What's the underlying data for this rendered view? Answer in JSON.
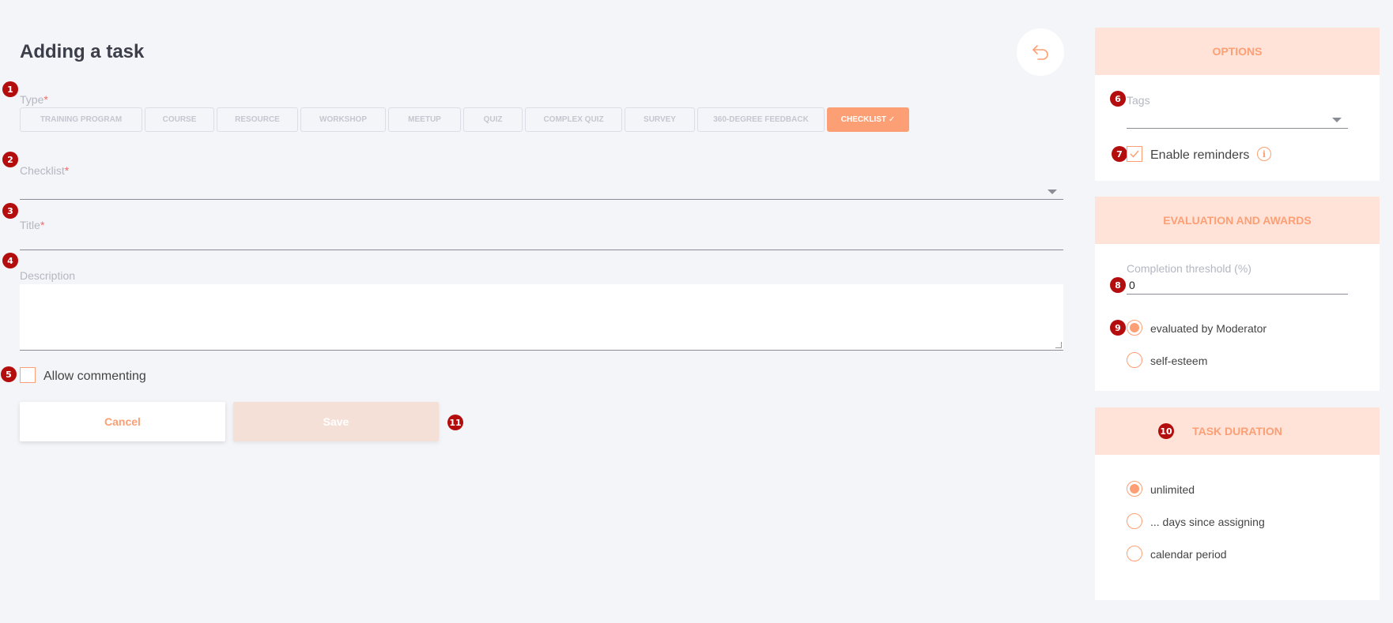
{
  "page": {
    "title": "Adding a task"
  },
  "form": {
    "type_label": "Type",
    "type_required": "*",
    "type_options": [
      "TRAINING PROGRAM",
      "COURSE",
      "RESOURCE",
      "WORKSHOP",
      "MEETUP",
      "QUIZ",
      "COMPLEX QUIZ",
      "SURVEY",
      "360-DEGREE FEEDBACK",
      "CHECKLIST"
    ],
    "type_selected": "CHECKLIST",
    "type_selected_mark": "✓",
    "checklist_label": "Checklist",
    "checklist_required": "*",
    "checklist_value": "",
    "title_label": "Title",
    "title_required": "*",
    "title_value": "",
    "description_label": "Description",
    "description_value": "",
    "allow_commenting_label": "Allow commenting",
    "allow_commenting_checked": false,
    "cancel_label": "Cancel",
    "save_label": "Save"
  },
  "options": {
    "header": "OPTIONS",
    "tags_label": "Tags",
    "tags_value": "",
    "reminders_label": "Enable reminders",
    "reminders_checked": true,
    "info_icon": "i"
  },
  "evaluation": {
    "header": "EVALUATION AND AWARDS",
    "threshold_label": "Completion threshold (%)",
    "threshold_value": "0",
    "options": [
      "evaluated by Moderator",
      "self-esteem"
    ],
    "selected": "evaluated by Moderator"
  },
  "duration": {
    "header": "TASK DURATION",
    "options": [
      "unlimited",
      "... days since assigning",
      "calendar period"
    ],
    "selected": "unlimited"
  },
  "badges": [
    "1",
    "2",
    "3",
    "4",
    "5",
    "6",
    "7",
    "8",
    "9",
    "10",
    "11"
  ],
  "colors": {
    "accent": "#fd9f74",
    "accent_light": "#ffe3d8",
    "badge": "#b40d0d",
    "background": "#f4f5f9"
  }
}
